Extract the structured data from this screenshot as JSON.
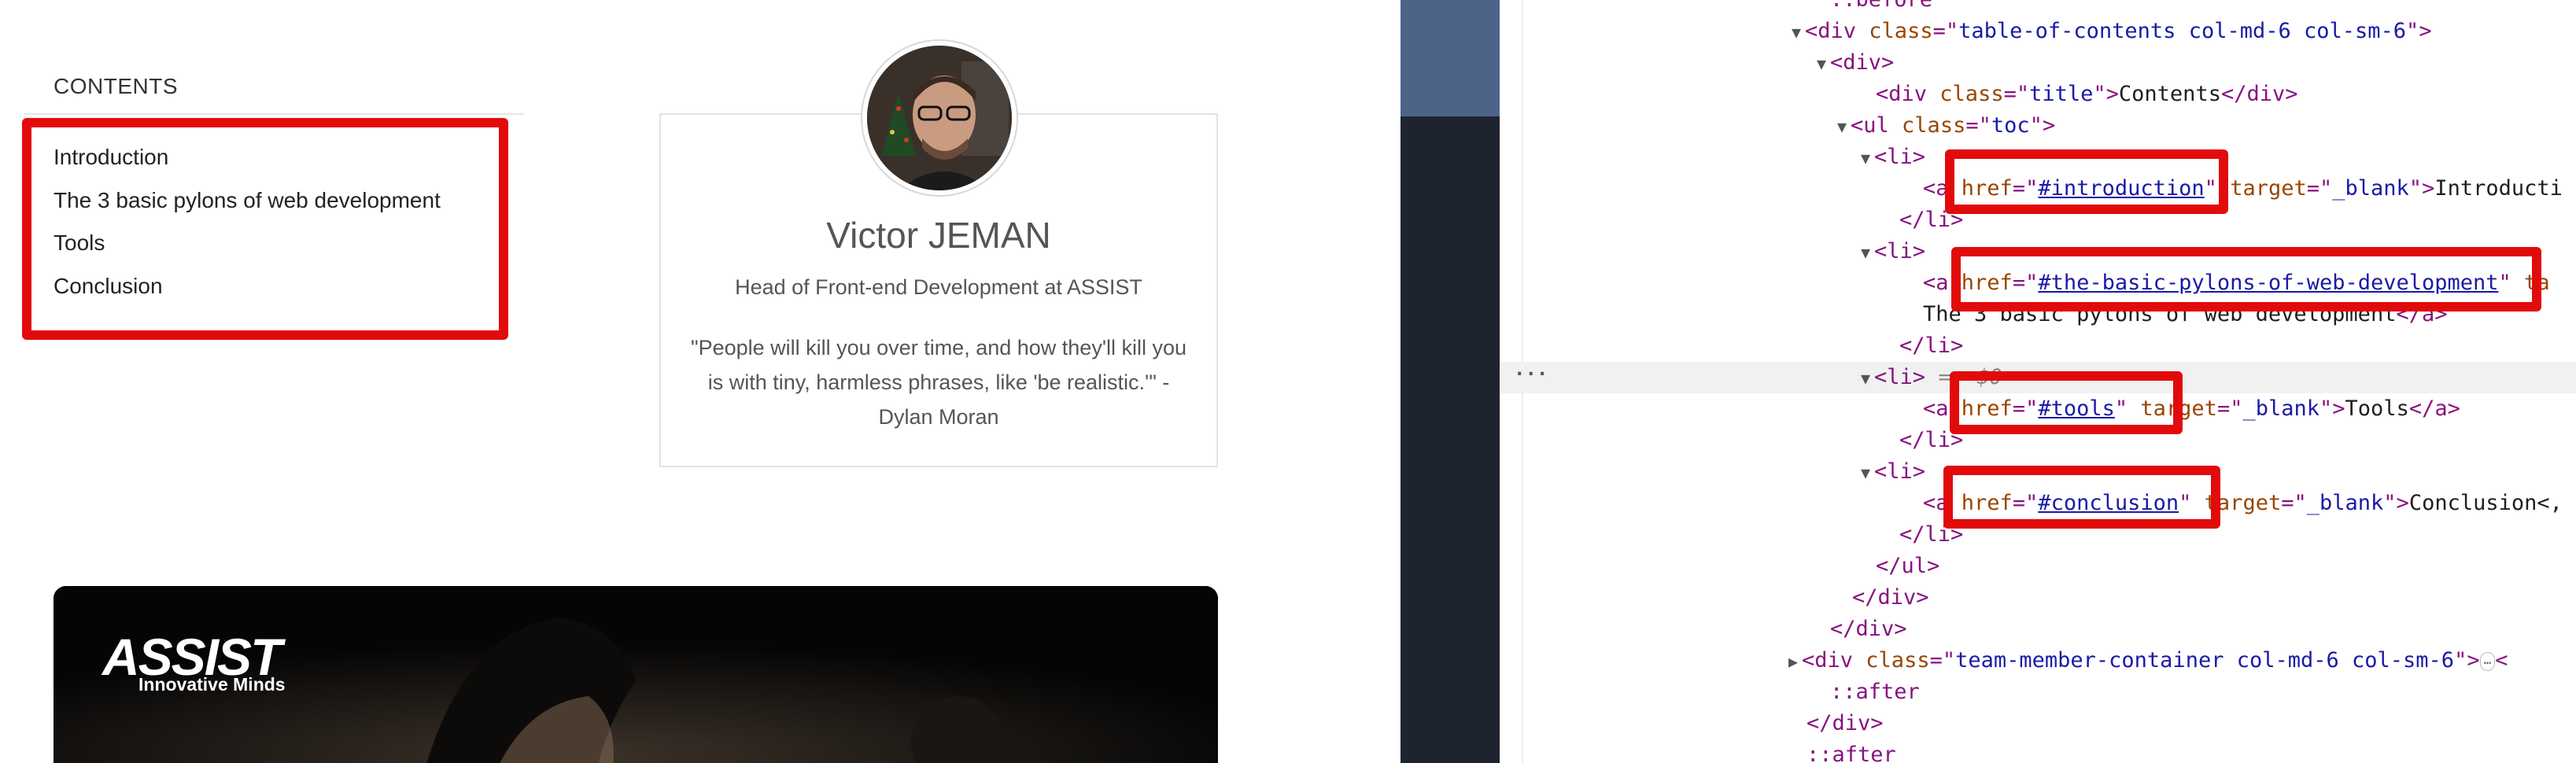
{
  "toc": {
    "title": "CONTENTS",
    "items": [
      {
        "label": "Introduction"
      },
      {
        "label": "The 3 basic pylons of web development"
      },
      {
        "label": "Tools"
      },
      {
        "label": "Conclusion"
      }
    ]
  },
  "member": {
    "name": "Victor JEMAN",
    "role": "Head of Front-end Development at ASSIST",
    "quote": "\"People will kill you over time, and how they'll kill you is with tiny, harmless phrases, like 'be realistic.'\" - Dylan Moran"
  },
  "hero": {
    "logo": "ASSIST",
    "tagline": "Innovative Minds"
  },
  "devtools": {
    "lines": [
      {
        "pseudo": "::before"
      },
      {
        "open": "div",
        "attrs": [
          {
            "name": "class",
            "value": "table-of-contents col-md-6 col-sm-6"
          }
        ]
      },
      {
        "open": "div"
      },
      {
        "open": "div",
        "attrs": [
          {
            "name": "class",
            "value": "title"
          }
        ],
        "text": "Contents",
        "close": "div"
      },
      {
        "open": "ul",
        "attrs": [
          {
            "name": "class",
            "value": "toc"
          }
        ]
      },
      {
        "open": "li"
      },
      {
        "open": "a",
        "attrs": [
          {
            "name": "href",
            "value": "#introduction"
          },
          {
            "name": "target",
            "value": "_blank"
          }
        ],
        "text": "Introducti"
      },
      {
        "close": "li"
      },
      {
        "open": "li"
      },
      {
        "open": "a",
        "attrs": [
          {
            "name": "href",
            "value": "#the-basic-pylons-of-web-development"
          },
          {
            "name": "ta",
            "value": ""
          }
        ]
      },
      {
        "text": "The 3 basic pylons of web development",
        "close": "a"
      },
      {
        "close": "li"
      },
      {
        "open": "li",
        "marker": "== $0"
      },
      {
        "open": "a",
        "attrs": [
          {
            "name": "href",
            "value": "#tools"
          },
          {
            "name": "target",
            "value": "_blank"
          }
        ],
        "text": "Tools",
        "close": "a"
      },
      {
        "close": "li"
      },
      {
        "open": "li"
      },
      {
        "open": "a",
        "attrs": [
          {
            "name": "href",
            "value": "#conclusion"
          },
          {
            "name": "target",
            "value": "_blank"
          }
        ],
        "text": "Conclusion<,"
      },
      {
        "close": "li"
      },
      {
        "close": "ul"
      },
      {
        "close": "div"
      },
      {
        "close": "div"
      },
      {
        "open": "div",
        "attrs": [
          {
            "name": "class",
            "value": "team-member-container col-md-6 col-sm-6"
          }
        ],
        "collapsed": "…"
      },
      {
        "pseudo": "::after"
      },
      {
        "close": "div"
      },
      {
        "pseudo": "::after"
      }
    ]
  },
  "colors": {
    "highlight_box": "#e10b0b",
    "tag": "#881280",
    "attr_name": "#994500",
    "attr_value": "#1a1aa6"
  }
}
